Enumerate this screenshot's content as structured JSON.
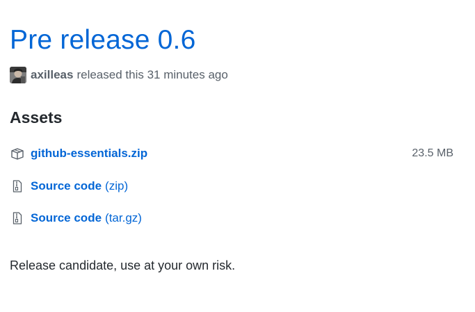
{
  "release": {
    "title": "Pre release 0.6",
    "author": "axilleas",
    "released_text": "released this 31 minutes ago",
    "avatar_icon": "user-avatar",
    "link_color": "#0366d6"
  },
  "assets": {
    "heading": "Assets",
    "items": [
      {
        "icon": "package-icon",
        "label": "github-essentials.zip",
        "suffix": "",
        "size": "23.5 MB"
      },
      {
        "icon": "file-zip-icon",
        "label": "Source code",
        "suffix": "(zip)",
        "size": ""
      },
      {
        "icon": "file-zip-icon",
        "label": "Source code",
        "suffix": "(tar.gz)",
        "size": ""
      }
    ]
  },
  "notes": {
    "body": "Release candidate, use at your own risk."
  }
}
